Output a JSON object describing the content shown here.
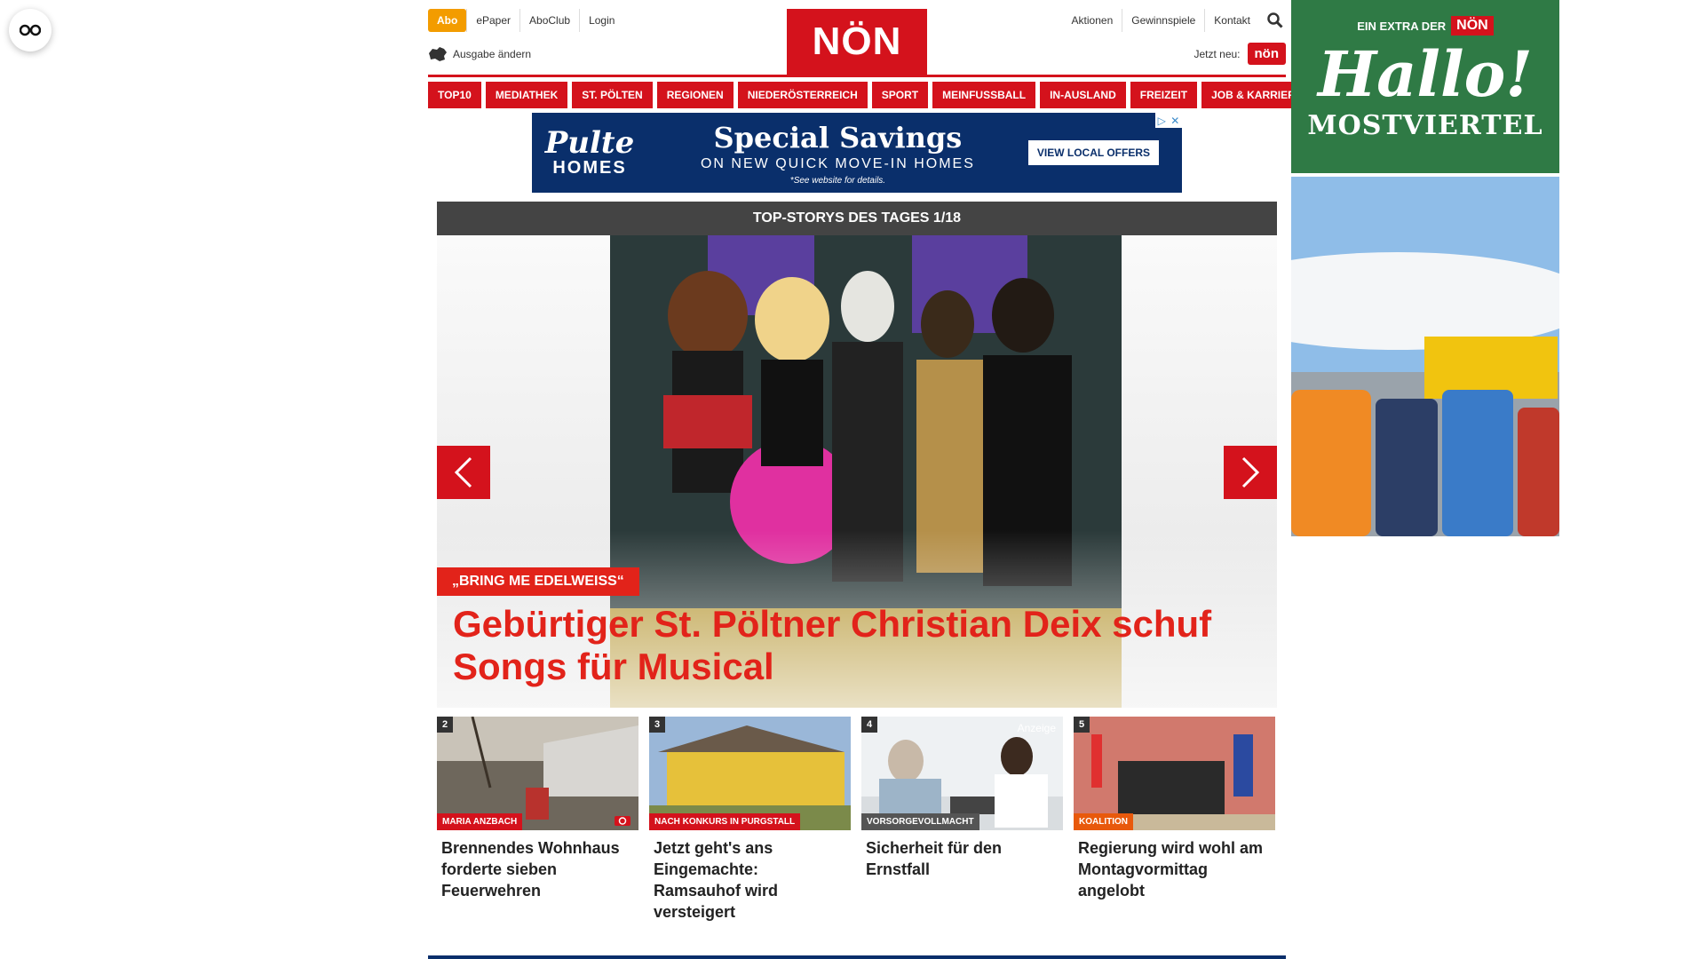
{
  "header": {
    "abo": "Abo",
    "left_links": [
      "ePaper",
      "AboClub",
      "Login"
    ],
    "edition": "Ausgabe ändern",
    "logo": "NÖN",
    "right_links": [
      "Aktionen",
      "Gewinnspiele",
      "Kontakt"
    ],
    "new_label": "Jetzt neu:",
    "new_logo": "nön"
  },
  "nav": [
    "TOP10",
    "MEDIATHEK",
    "ST. PÖLTEN",
    "REGIONEN",
    "NIEDERÖSTERREICH",
    "SPORT",
    "MEINFUSSBALL",
    "IN-AUSLAND",
    "FREIZEIT",
    "JOB & KARRIERE"
  ],
  "ad_banner": {
    "brand_top": "Pulte",
    "brand_bottom": "HOMES",
    "headline": "Special Savings",
    "sub": "ON NEW QUICK MOVE-IN HOMES",
    "note": "*See website for details.",
    "cta": "VIEW LOCAL OFFERS"
  },
  "top_stories": {
    "header": "TOP-STORYS DES TAGES 1/18",
    "hero": {
      "tag": "„BRING ME EDELWEISS“",
      "title": "Gebürtiger St. Pöltner Christian Deix schuf Songs für Musical"
    },
    "teasers": [
      {
        "num": "2",
        "cat": "MARIA ANZBACH",
        "title": "Brennendes Wohnhaus forderte sieben Feuerwehren"
      },
      {
        "num": "3",
        "cat": "NACH KONKURS IN PURGSTALL",
        "title": "Jetzt geht's ans Eingemachte: Ramsauhof wird versteigert"
      },
      {
        "num": "4",
        "cat": "VORSORGEVOLLMACHT",
        "title": "Sicherheit für den Ernstfall",
        "badge": "Anzeige"
      },
      {
        "num": "5",
        "cat": "KOALITION",
        "title": "Regierung wird wohl am Montagvormittag angelobt"
      }
    ]
  },
  "side_ad": {
    "extra": "EIN EXTRA DER",
    "mini_logo": "NÖN",
    "hallo": "Hallo!",
    "region": "MOSTVIERTEL"
  },
  "colors": {
    "brand_red": "#d4121c",
    "abo_orange": "#f39c00",
    "ad_navy": "#0a2f6b",
    "side_green": "#2f7a45"
  }
}
